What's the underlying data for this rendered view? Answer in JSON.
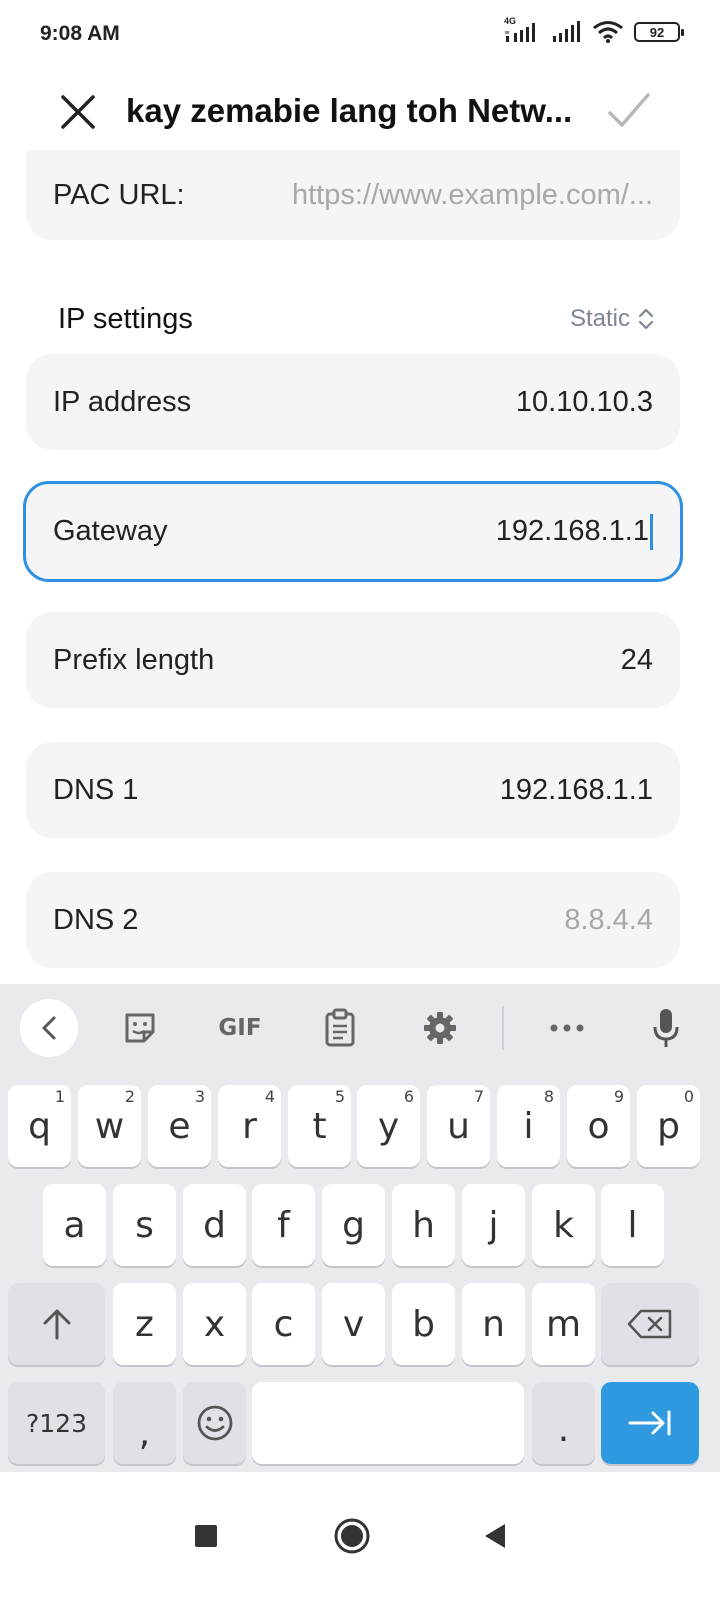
{
  "status_bar": {
    "time": "9:08 AM",
    "network": "4G",
    "battery": "92"
  },
  "header": {
    "title": "kay zemabie lang toh Netw..."
  },
  "proxy": {
    "pac_label": "PAC URL:",
    "pac_placeholder": "https://www.example.com/..."
  },
  "ip_settings": {
    "title": "IP settings",
    "mode": "Static",
    "fields": [
      {
        "label": "IP address",
        "value": "10.10.10.3"
      },
      {
        "label": "Gateway",
        "value": "192.168.1.1"
      },
      {
        "label": "Prefix length",
        "value": "24"
      },
      {
        "label": "DNS 1",
        "value": "192.168.1.1"
      },
      {
        "label": "DNS 2",
        "placeholder": "8.8.4.4"
      }
    ]
  },
  "keyboard": {
    "toolbar": {
      "gif": "GIF"
    },
    "row1": [
      {
        "key": "q",
        "hint": "1"
      },
      {
        "key": "w",
        "hint": "2"
      },
      {
        "key": "e",
        "hint": "3"
      },
      {
        "key": "r",
        "hint": "4"
      },
      {
        "key": "t",
        "hint": "5"
      },
      {
        "key": "y",
        "hint": "6"
      },
      {
        "key": "u",
        "hint": "7"
      },
      {
        "key": "i",
        "hint": "8"
      },
      {
        "key": "o",
        "hint": "9"
      },
      {
        "key": "p",
        "hint": "0"
      }
    ],
    "row2": [
      "a",
      "s",
      "d",
      "f",
      "g",
      "h",
      "j",
      "k",
      "l"
    ],
    "row3": [
      "z",
      "x",
      "c",
      "v",
      "b",
      "n",
      "m"
    ],
    "symbols": "?123",
    "comma": ",",
    "period": "."
  },
  "colors": {
    "accent": "#2f8fe0",
    "enter_key": "#2f9ae0",
    "card_bg": "#f5f5f5",
    "keyboard_bg": "#e9eaee"
  }
}
